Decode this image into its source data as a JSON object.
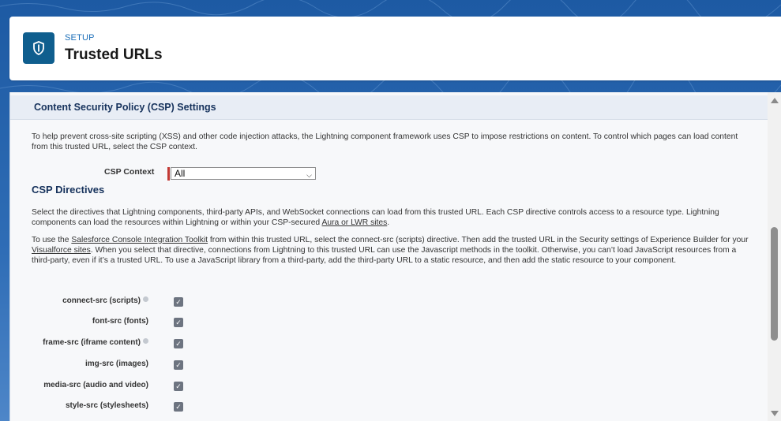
{
  "header": {
    "breadcrumb": "SETUP",
    "title": "Trusted URLs",
    "icon": "shield-icon"
  },
  "section": {
    "title": "Content Security Policy (CSP) Settings",
    "intro": "To help prevent cross-site scripting (XSS) and other code injection attacks, the Lightning component framework uses CSP to impose restrictions on content. To control which pages can load content from this trusted URL, select the CSP context.",
    "csp_context_label": "CSP Context",
    "csp_context_value": "All",
    "directives_title": "CSP Directives",
    "directives_intro_part1": "Select the directives that Lightning components, third-party APIs, and WebSocket connections can load from this trusted URL. Each CSP directive controls access to a resource type. Lightning components can load the resources within Lightning or within your CSP-secured ",
    "directives_intro_link": "Aura or LWR sites",
    "directives_intro_part2": ".",
    "console_p1": "To use the ",
    "console_link1": "Salesforce Console Integration Toolkit",
    "console_p2": " from within this trusted URL, select the connect-src (scripts) directive. Then add the trusted URL in the Security settings of Experience Builder for your ",
    "console_link2": "Visualforce sites",
    "console_p3": ". When you select that directive, connections from Lightning to this trusted URL can use the Javascript methods in the toolkit. Otherwise, you can’t load JavaScript resources from a third-party, even if it’s a trusted URL. To use a JavaScript library from a third-party, add the third-party URL to a static resource, and then add the static resource to your component."
  },
  "directives": [
    {
      "label": "connect-src (scripts)",
      "info": true,
      "checked": true
    },
    {
      "label": "font-src (fonts)",
      "info": false,
      "checked": true
    },
    {
      "label": "frame-src (iframe content)",
      "info": true,
      "checked": true
    },
    {
      "label": "img-src (images)",
      "info": false,
      "checked": true
    },
    {
      "label": "media-src (audio and video)",
      "info": false,
      "checked": true
    },
    {
      "label": "style-src (stylesheets)",
      "info": false,
      "checked": true
    }
  ],
  "colors": {
    "banner": "#1d5aa3",
    "icon_bg": "#0f5e8e",
    "link": "#1b6eb8",
    "required": "#c23934"
  }
}
